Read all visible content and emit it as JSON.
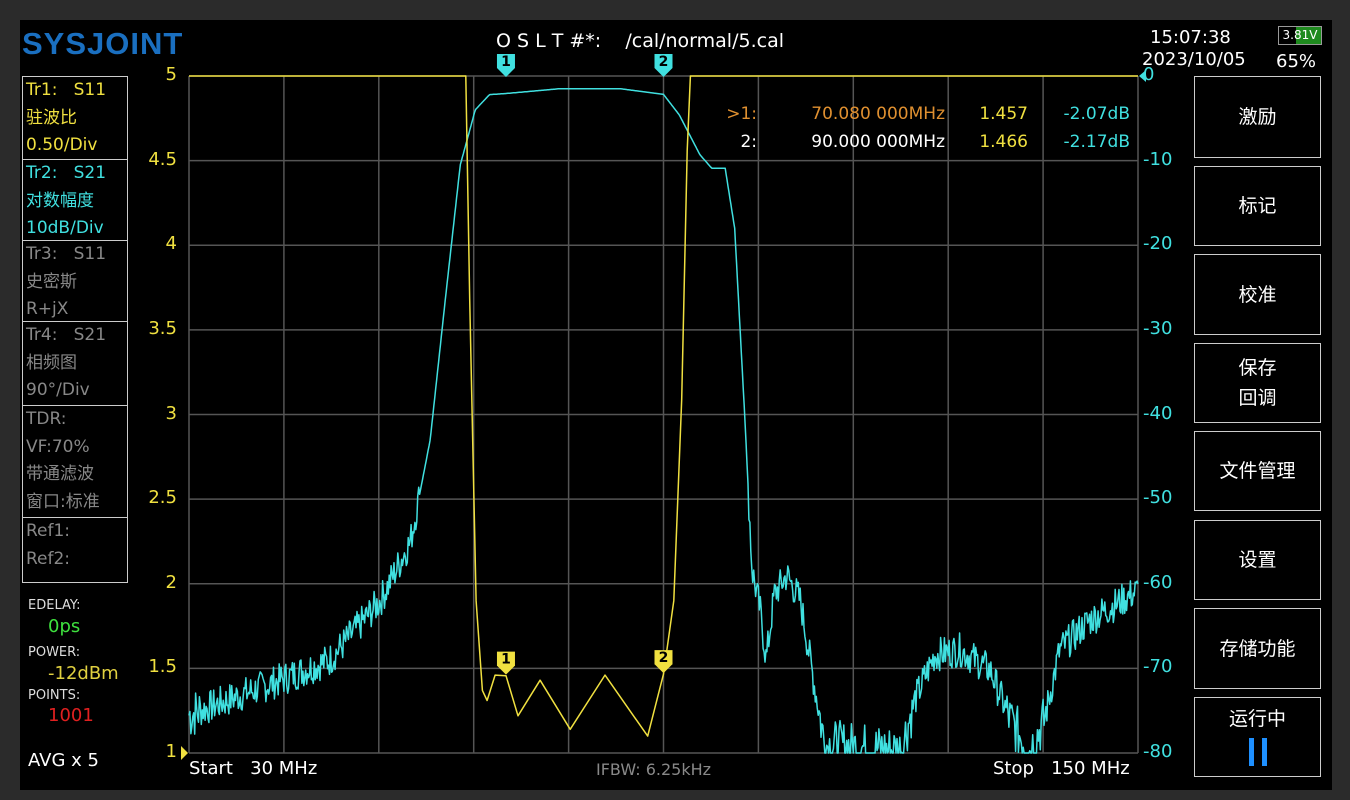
{
  "header": {
    "logo": "SYSJOINT",
    "cal_label": "O S L T #*:    /cal/normal/5.cal",
    "time": "15:07:38",
    "date": "2023/10/05",
    "battery_voltage": "3.81V",
    "battery_percent": "65%"
  },
  "traces": [
    {
      "l1": "Tr1:   S11",
      "l2": "驻波比",
      "l3": "0.50/Div"
    },
    {
      "l1": "Tr2:   S21",
      "l2": "对数幅度",
      "l3": "10dB/Div"
    },
    {
      "l1": "Tr3:   S11",
      "l2": "史密斯",
      "l3": "R+jX"
    },
    {
      "l1": "Tr4:   S21",
      "l2": "相频图",
      "l3": "90°/Div"
    },
    {
      "l1": "TDR:",
      "l2": "VF:70%",
      "l3": "带通滤波",
      "l4": "窗口:标准"
    },
    {
      "l1": "Ref1:",
      "l2": "Ref2:"
    }
  ],
  "status": {
    "edelay_label": "EDELAY:",
    "edelay": "0ps",
    "power_label": "POWER:",
    "power": "-12dBm",
    "points_label": "POINTS:",
    "points": "1001",
    "avg": "AVG x 5"
  },
  "footer": {
    "start": "Start   30 MHz",
    "ifbw": "IFBW: 6.25kHz",
    "stop": "Stop   150 MHz"
  },
  "markers": [
    {
      "id": ">1:",
      "freq": "70.080 000MHz",
      "swr": "1.457",
      "db": "-2.07dB"
    },
    {
      "id": "2:",
      "freq": "90.000 000MHz",
      "swr": "1.466",
      "db": "-2.17dB"
    }
  ],
  "menu": [
    "激励",
    "标记",
    "校准",
    "保存\n回调",
    "文件管理",
    "设置",
    "存储功能",
    "运行中"
  ],
  "chart_data": {
    "type": "line",
    "x_range": [
      30,
      150
    ],
    "x_unit": "MHz",
    "left_axis": {
      "ticks": [
        "5",
        "4.5",
        "4",
        "3.5",
        "3",
        "2.5",
        "2",
        "1.5",
        "1"
      ],
      "range": [
        1,
        5
      ]
    },
    "right_axis": {
      "ticks": [
        "0",
        "-10",
        "-20",
        "-30",
        "-40",
        "-50",
        "-60",
        "-70",
        "-80"
      ],
      "range": [
        -80,
        0
      ]
    },
    "series": [
      {
        "name": "Tr2 S21 LogMag",
        "color": "#40e0e0",
        "axis": "right",
        "points": [
          [
            30,
            -75.5
          ],
          [
            41.5,
            -71.4
          ],
          [
            47.8,
            -69
          ],
          [
            54.2,
            -62
          ],
          [
            58,
            -55
          ],
          [
            60.5,
            -43
          ],
          [
            62.4,
            -26.5
          ],
          [
            64.3,
            -10.5
          ],
          [
            66.2,
            -4
          ],
          [
            68,
            -2.2
          ],
          [
            70.08,
            -2.07
          ],
          [
            76.9,
            -1.5
          ],
          [
            84.5,
            -1.5
          ],
          [
            90,
            -2.17
          ],
          [
            92,
            -4.6
          ],
          [
            94.6,
            -9.3
          ],
          [
            96.1,
            -10.9
          ],
          [
            97.8,
            -10.9
          ],
          [
            99,
            -18
          ],
          [
            100.3,
            -40.7
          ],
          [
            101.2,
            -58.4
          ],
          [
            102.2,
            -63
          ],
          [
            103,
            -69
          ],
          [
            104,
            -61.3
          ],
          [
            105.6,
            -59
          ],
          [
            107.3,
            -62
          ],
          [
            109.2,
            -72.6
          ],
          [
            110.4,
            -79
          ],
          [
            120,
            -79.7
          ],
          [
            121.8,
            -73.7
          ],
          [
            124.3,
            -68.4
          ],
          [
            127.5,
            -67.8
          ],
          [
            131.3,
            -70.2
          ],
          [
            133.8,
            -76
          ],
          [
            136.3,
            -79.7
          ],
          [
            138.2,
            -76
          ],
          [
            140.1,
            -67.8
          ],
          [
            143.9,
            -64.3
          ],
          [
            150,
            -60.8
          ]
        ]
      },
      {
        "name": "Tr1 S11 SWR",
        "color": "#f0e040",
        "axis": "left",
        "points": [
          [
            30,
            5
          ],
          [
            64.6,
            5
          ],
          [
            65,
            5
          ],
          [
            65.5,
            3.68
          ],
          [
            66.3,
            1.9
          ],
          [
            67.1,
            1.37
          ],
          [
            67.7,
            1.31
          ],
          [
            68.7,
            1.46
          ],
          [
            70.08,
            1.457
          ],
          [
            71.6,
            1.22
          ],
          [
            74.4,
            1.43
          ],
          [
            78.2,
            1.14
          ],
          [
            82.6,
            1.46
          ],
          [
            88,
            1.1
          ],
          [
            90,
            1.466
          ],
          [
            91.3,
            1.9
          ],
          [
            92.3,
            3.09
          ],
          [
            93,
            4.56
          ],
          [
            93.4,
            5
          ],
          [
            150,
            5
          ]
        ]
      }
    ],
    "marker_freqs": [
      70.08,
      90
    ]
  }
}
